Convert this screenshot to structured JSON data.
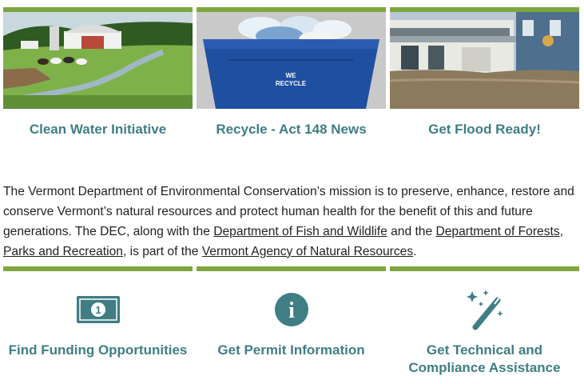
{
  "features": [
    {
      "title": "Clean Water Initiative",
      "image": "farm-stream-photo"
    },
    {
      "title": "Recycle - Act 148 News",
      "image": "recycling-bin-photo",
      "bin_text_1": "WE",
      "bin_text_2": "RECYCLE"
    },
    {
      "title": "Get Flood Ready!",
      "image": "flooded-street-photo"
    }
  ],
  "mission": {
    "text_1": "The Vermont Department of Environmental Conservation’s mission is to preserve, enhance, restore and conserve Vermont’s natural resources and protect human health for the benefit of this and future generations. The DEC, along with the ",
    "link_fish": "Department of Fish and Wildlife",
    "text_2": " and the ",
    "link_forests": "Department of Forests, Parks and Recreation",
    "text_3": ", is part of the ",
    "link_anr": "Vermont Agency of Natural Resources",
    "text_4": "."
  },
  "actions": [
    {
      "label": "Find Funding Opportunities",
      "icon": "money-bill-icon",
      "bill_glyph": "1"
    },
    {
      "label": "Get Permit Information",
      "icon": "info-circle-icon",
      "info_glyph": "i"
    },
    {
      "label": "Get Technical and Compliance Assistance",
      "icon": "magic-wand-icon"
    }
  ],
  "colors": {
    "accent_bar": "#7ea63f",
    "link_teal": "#3e7e84"
  }
}
